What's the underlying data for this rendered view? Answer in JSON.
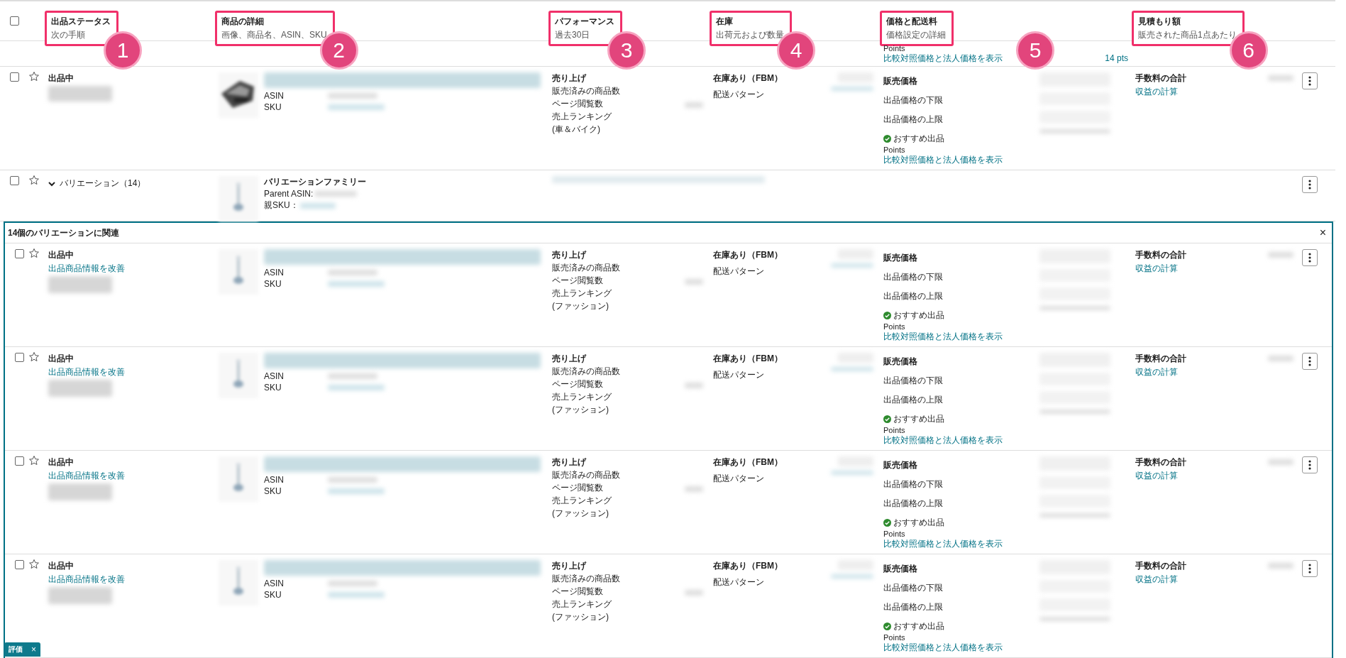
{
  "header": {
    "select_all_checked": false,
    "columns": [
      {
        "title": "出品ステータス",
        "subtitle": "次の手順",
        "callout": "1"
      },
      {
        "title": "商品の詳細",
        "subtitle": "画像、商品名、ASIN、SKU",
        "callout": "2"
      },
      {
        "title": "パフォーマンス",
        "subtitle": "過去30日",
        "callout": "3"
      },
      {
        "title": "在庫",
        "subtitle": "出荷元および数量",
        "callout": "4"
      },
      {
        "title": "価格と配送料",
        "subtitle": "価格設定の詳細",
        "callout": "5"
      },
      {
        "title": "見積もり額",
        "subtitle": "販売された商品1点あたり",
        "callout": "6"
      }
    ]
  },
  "partial_row": {
    "points": "Points",
    "compare_link": "比較対照価格と法人価格を表示",
    "points_value": "14 pts"
  },
  "rows": [
    {
      "kind": "listing",
      "checked": false,
      "starred": false,
      "status": "出品中",
      "asin_label": "ASIN",
      "sku_label": "SKU",
      "perf_title": "売り上げ",
      "perf_items": [
        "販売済みの商品数",
        "ページ閲覧数",
        "売上ランキング",
        "(車＆バイク)"
      ],
      "stock": "在庫あり（FBM）",
      "shipping": "配送パターン",
      "price_title": "販売価格",
      "price_min": "出品価格の下限",
      "price_max": "出品価格の上限",
      "featured": "おすすめ出品",
      "points": "Points",
      "compare_link": "比較対照価格と法人価格を表示",
      "fee_title": "手数料の合計",
      "profit_link": "収益の計算"
    },
    {
      "kind": "variation",
      "checked": false,
      "starred": false,
      "expanded": true,
      "toggle": "バリエーション（14）",
      "family": "バリエーションファミリー",
      "parent_asin": "Parent ASIN:",
      "parent_sku": "親SKU："
    }
  ],
  "variation_group": {
    "title": "14個のバリエーションに関連",
    "close": "×",
    "rows": [
      {
        "kind": "listing",
        "checked": false,
        "starred": false,
        "status": "出品中",
        "improve_link": "出品商品情報を改善",
        "asin_label": "ASIN",
        "sku_label": "SKU",
        "perf_title": "売り上げ",
        "perf_items": [
          "販売済みの商品数",
          "ページ閲覧数",
          "売上ランキング",
          "(ファッション)"
        ],
        "stock": "在庫あり（FBM）",
        "shipping": "配送パターン",
        "price_title": "販売価格",
        "price_min": "出品価格の下限",
        "price_max": "出品価格の上限",
        "featured": "おすすめ出品",
        "points": "Points",
        "compare_link": "比較対照価格と法人価格を表示",
        "fee_title": "手数料の合計",
        "profit_link": "収益の計算"
      },
      {
        "kind": "listing",
        "checked": false,
        "starred": false,
        "status": "出品中",
        "improve_link": "出品商品情報を改善",
        "asin_label": "ASIN",
        "sku_label": "SKU",
        "perf_title": "売り上げ",
        "perf_items": [
          "販売済みの商品数",
          "ページ閲覧数",
          "売上ランキング",
          "(ファッション)"
        ],
        "stock": "在庫あり（FBM）",
        "shipping": "配送パターン",
        "price_title": "販売価格",
        "price_min": "出品価格の下限",
        "price_max": "出品価格の上限",
        "featured": "おすすめ出品",
        "points": "Points",
        "compare_link": "比較対照価格と法人価格を表示",
        "fee_title": "手数料の合計",
        "profit_link": "収益の計算"
      },
      {
        "kind": "listing",
        "checked": false,
        "starred": false,
        "status": "出品中",
        "improve_link": "出品商品情報を改善",
        "asin_label": "ASIN",
        "sku_label": "SKU",
        "perf_title": "売り上げ",
        "perf_items": [
          "販売済みの商品数",
          "ページ閲覧数",
          "売上ランキング",
          "(ファッション)"
        ],
        "stock": "在庫あり（FBM）",
        "shipping": "配送パターン",
        "price_title": "販売価格",
        "price_min": "出品価格の下限",
        "price_max": "出品価格の上限",
        "featured": "おすすめ出品",
        "points": "Points",
        "compare_link": "比較対照価格と法人価格を表示",
        "fee_title": "手数料の合計",
        "profit_link": "収益の計算"
      },
      {
        "kind": "listing",
        "checked": false,
        "starred": false,
        "status": "出品中",
        "improve_link": "出品商品情報を改善",
        "asin_label": "ASIN",
        "sku_label": "SKU",
        "perf_title": "売り上げ",
        "perf_items": [
          "販売済みの商品数",
          "ページ閲覧数",
          "売上ランキング",
          "(ファッション)"
        ],
        "stock": "在庫あり（FBM）",
        "shipping": "配送パターン",
        "price_title": "販売価格",
        "price_min": "出品価格の下限",
        "price_max": "出品価格の上限",
        "featured": "おすすめ出品",
        "points": "Points",
        "compare_link": "比較対照価格と法人価格を表示",
        "fee_title": "手数料の合計",
        "profit_link": "収益の計算"
      }
    ]
  },
  "feedback_tab": {
    "label": "評価",
    "close": "×"
  }
}
